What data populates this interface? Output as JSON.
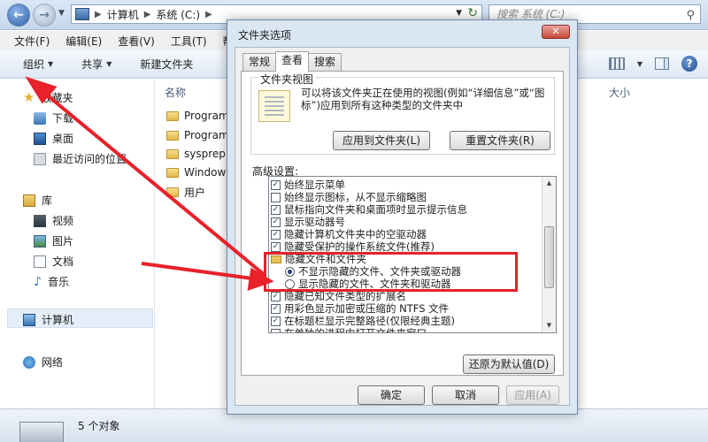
{
  "explorer": {
    "address": {
      "segments": [
        "计算机",
        "系统 (C:)"
      ]
    },
    "search_placeholder": "搜索 系统 (C:)",
    "menu": [
      "文件(F)",
      "编辑(E)",
      "查看(V)",
      "工具(T)",
      "帮助"
    ],
    "toolbar": {
      "organize": "组织",
      "share": "共享",
      "new_folder": "新建文件夹"
    },
    "nav": {
      "favorites": "收藏夹",
      "downloads": "下载",
      "desktop": "桌面",
      "recent": "最近访问的位置",
      "library": "库",
      "videos": "视频",
      "pictures": "图片",
      "documents": "文档",
      "music": "音乐",
      "computer": "计算机",
      "network": "网络"
    },
    "columns": {
      "name": "名称",
      "size": "大小"
    },
    "files": [
      "Program",
      "Program",
      "sysprep",
      "Windows",
      "用户"
    ],
    "status": "5 个对象"
  },
  "dialog": {
    "title": "文件夹选项",
    "close": "✕",
    "tabs": [
      "常规",
      "查看",
      "搜索"
    ],
    "folder_views": {
      "label": "文件夹视图",
      "description": "可以将该文件夹正在使用的视图(例如“详细信息”或“图标”)应用到所有这种类型的文件夹中",
      "apply_button": "应用到文件夹(L)",
      "reset_button": "重置文件夹(R)"
    },
    "advanced_label": "高级设置:",
    "advanced_items": [
      {
        "type": "checkbox",
        "checked": true,
        "label": "始终显示菜单"
      },
      {
        "type": "checkbox",
        "checked": false,
        "label": "始终显示图标，从不显示缩略图"
      },
      {
        "type": "checkbox",
        "checked": true,
        "label": "鼠标指向文件夹和桌面项时显示提示信息"
      },
      {
        "type": "checkbox",
        "checked": true,
        "label": "显示驱动器号"
      },
      {
        "type": "checkbox",
        "checked": true,
        "label": "隐藏计算机文件夹中的空驱动器"
      },
      {
        "type": "checkbox",
        "checked": true,
        "label": "隐藏受保护的操作系统文件(推荐)"
      },
      {
        "type": "folder",
        "label": "隐藏文件和文件夹"
      },
      {
        "type": "radio",
        "checked": true,
        "label": "不显示隐藏的文件、文件夹或驱动器"
      },
      {
        "type": "radio",
        "checked": false,
        "label": "显示隐藏的文件、文件夹和驱动器"
      },
      {
        "type": "checkbox",
        "checked": true,
        "label": "隐藏已知文件类型的扩展名"
      },
      {
        "type": "checkbox",
        "checked": true,
        "label": "用彩色显示加密或压缩的 NTFS 文件"
      },
      {
        "type": "checkbox",
        "checked": true,
        "label": "在标题栏显示完整路径(仅限经典主题)"
      },
      {
        "type": "checkbox",
        "checked": false,
        "label": "在单独的进程中打开文件夹窗口"
      }
    ],
    "restore_button": "还原为默认值(D)",
    "ok": "确定",
    "cancel": "取消",
    "apply": "应用(A)"
  },
  "annotation_color": "#e8212a"
}
